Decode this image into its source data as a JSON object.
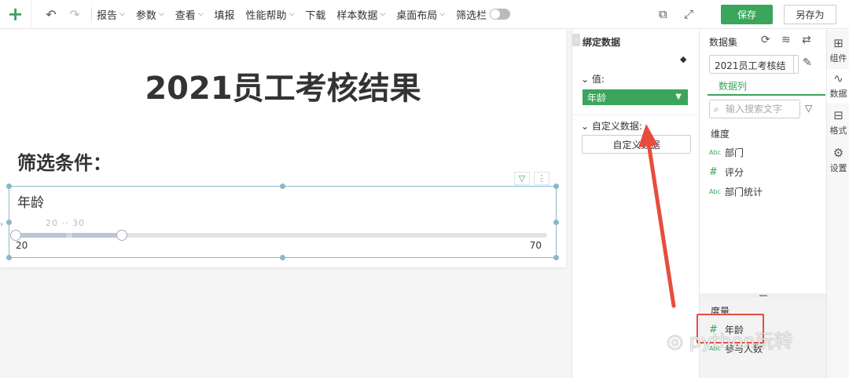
{
  "toolbar": {
    "menus": [
      {
        "label": "报告",
        "dropdown": true
      },
      {
        "label": "参数",
        "dropdown": true
      },
      {
        "label": "查看",
        "dropdown": true
      },
      {
        "label": "填报",
        "dropdown": false
      },
      {
        "label": "性能帮助",
        "dropdown": true
      },
      {
        "label": "下载",
        "dropdown": false
      },
      {
        "label": "样本数据",
        "dropdown": true
      },
      {
        "label": "桌面布局",
        "dropdown": true
      },
      {
        "label": "筛选栏",
        "dropdown": false
      }
    ],
    "save_label": "保存",
    "save_as_label": "另存为",
    "accent_color": "#3aa55b"
  },
  "report": {
    "title": "2021员工考核结果",
    "filter_title": "筛选条件：",
    "range_filter": {
      "label": "年龄",
      "selected_text": "20 ·· 30",
      "min": 20,
      "max": 70,
      "selected_low": 20,
      "selected_high": 30,
      "min_label": "20",
      "max_label": "70"
    }
  },
  "binding_panel": {
    "title": "绑定数据",
    "value_label": "值:",
    "value_field": "年龄",
    "custom_label": "自定义数据:",
    "custom_button": "自定义数据"
  },
  "dataset_panel": {
    "title": "数据集",
    "dataset_name": "2021员工考核结",
    "tab": "数据列",
    "search_placeholder": "输入搜索文字",
    "dimension_label": "维度",
    "dimensions": [
      {
        "type": "Abc",
        "name": "部门"
      },
      {
        "type": "#",
        "name": "评分"
      },
      {
        "type": "Abc",
        "name": "部门统计"
      }
    ],
    "measure_label": "度量",
    "measures": [
      {
        "type": "#",
        "name": "年龄"
      },
      {
        "type": "Abc",
        "name": "参与人数"
      }
    ]
  },
  "right_tabs": [
    {
      "label": "组件",
      "icon": "component-icon"
    },
    {
      "label": "数据",
      "icon": "data-icon",
      "active": true
    },
    {
      "label": "格式",
      "icon": "format-icon"
    },
    {
      "label": "设置",
      "icon": "gear-icon"
    }
  ],
  "watermark": "python玩转"
}
